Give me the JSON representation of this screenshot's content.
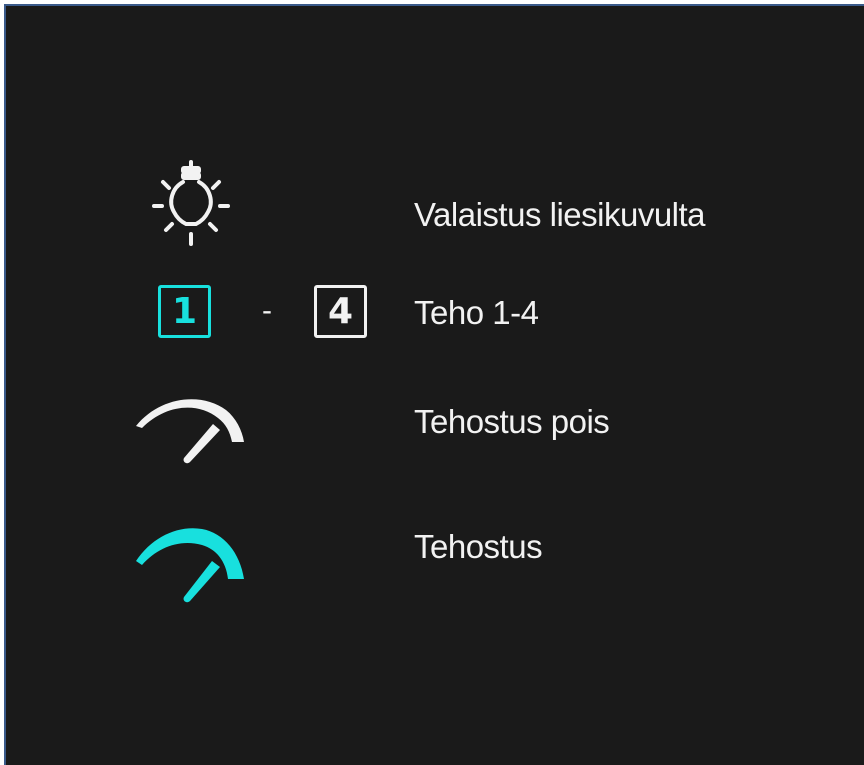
{
  "colors": {
    "background": "#1a1a1a",
    "frame_border": "#3a5a8a",
    "text": "#f2f2f2",
    "accent": "#18e0de"
  },
  "legend": [
    {
      "icon": "lightbulb-icon",
      "label": "Valaistus liesikuvulta"
    },
    {
      "icon": "power-level-icon",
      "label": "Teho 1-4"
    },
    {
      "icon": "gauge-icon",
      "label": "Tehostus pois"
    },
    {
      "icon": "gauge-boost-icon",
      "label": "Tehostus"
    }
  ],
  "power_levels": {
    "min": "1",
    "separator": "-",
    "max": "4"
  }
}
